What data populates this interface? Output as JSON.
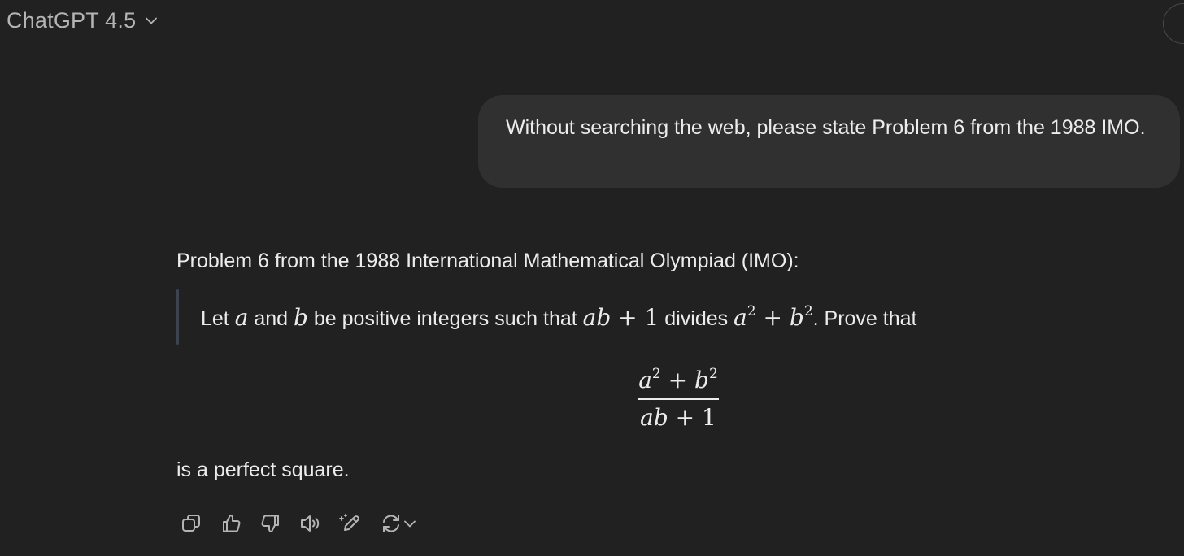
{
  "header": {
    "model_title": "ChatGPT 4.5",
    "chevron_icon": "chevron-down-icon"
  },
  "user_message": {
    "text": "Without searching the web, please state Problem 6 from the 1988 IMO."
  },
  "assistant_message": {
    "intro": "Problem 6 from the 1988 International Mathematical Olympiad (IMO):",
    "quote": {
      "t1": "Let ",
      "m1": "a",
      "t2": " and ",
      "m2": "b",
      "t3": " be positive integers such that ",
      "m3": "ab",
      "op1": " + 1",
      "t4": " divides ",
      "m4": "a",
      "sup1": "2",
      "op2": " + ",
      "m5": "b",
      "sup2": "2",
      "t5": ". Prove that"
    },
    "fraction": {
      "num_a": "a",
      "num_exp1": "2",
      "num_plus": " + ",
      "num_b": "b",
      "num_exp2": "2",
      "den_ab": "ab",
      "den_rest": " + 1"
    },
    "outro": "is a perfect square."
  },
  "actions": [
    {
      "icon": "copy-icon"
    },
    {
      "icon": "thumbs-up-icon"
    },
    {
      "icon": "thumbs-down-icon"
    },
    {
      "icon": "read-aloud-icon"
    },
    {
      "icon": "edit-canvas-icon"
    },
    {
      "icon": "regenerate-icon"
    }
  ],
  "colors": {
    "background": "#212121",
    "bubble": "#303030",
    "text": "#ececec",
    "muted": "#b4b4b4",
    "quote_bar": "#3d4450"
  }
}
